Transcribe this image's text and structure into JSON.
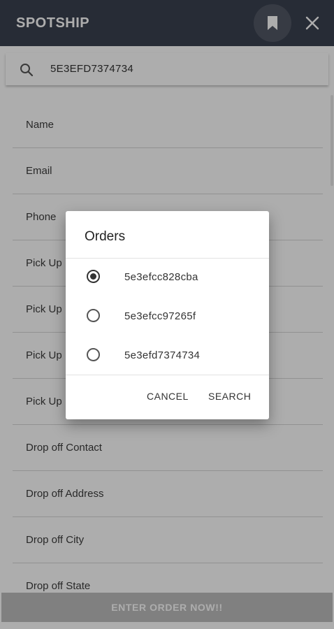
{
  "appbar": {
    "title": "SPOTSHIP"
  },
  "search": {
    "value": "5E3EFD7374734"
  },
  "fields": [
    "Name",
    "Email",
    "Phone",
    "Pick Up",
    "Pick Up",
    "Pick Up",
    "Pick Up",
    "Drop off Contact",
    "Drop off Address",
    "Drop off City",
    "Drop off State"
  ],
  "footer": {
    "button_label": "ENTER ORDER NOW!!"
  },
  "dialog": {
    "title": "Orders",
    "options": [
      {
        "label": "5e3efcc828cba",
        "selected": true
      },
      {
        "label": "5e3efcc97265f",
        "selected": false
      },
      {
        "label": "5e3efd7374734",
        "selected": false
      }
    ],
    "cancel_label": "CANCEL",
    "search_label": "SEARCH"
  },
  "colors": {
    "appbar": "#3a4150",
    "button_disabled": "#bdbdbd"
  },
  "icons": [
    "bookmark-icon",
    "close-icon",
    "search-icon"
  ]
}
